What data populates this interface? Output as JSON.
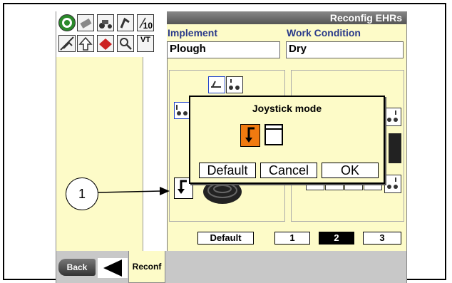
{
  "title": "Reconfig EHRs",
  "implement": {
    "label": "Implement",
    "value": "Plough"
  },
  "work_condition": {
    "label": "Work Condition",
    "value": "Dry"
  },
  "icons": [
    "gear-icon",
    "remote-icon",
    "tractor-icon",
    "hitch-icon",
    "timer-icon",
    "plough-icon",
    "up-arrow-icon",
    "book-icon",
    "search-icon",
    "vt-icon"
  ],
  "icon_texts": {
    "timer": "10",
    "vt": "VT"
  },
  "left_buttons": {
    "default": "Default"
  },
  "position_buttons": [
    "1",
    "2",
    "3"
  ],
  "selected_position": "2",
  "dialog": {
    "title": "Joystick mode",
    "default_label": "Default",
    "cancel_label": "Cancel",
    "ok_label": "OK"
  },
  "bottom": {
    "back_label": "Back",
    "reconf_label": "Reconf"
  },
  "callout": {
    "number": "1"
  },
  "colors": {
    "background": "#fdfbc8",
    "accent_orange": "#f07a10",
    "title_bar": "#666666",
    "label_blue": "#2a3a8a"
  }
}
